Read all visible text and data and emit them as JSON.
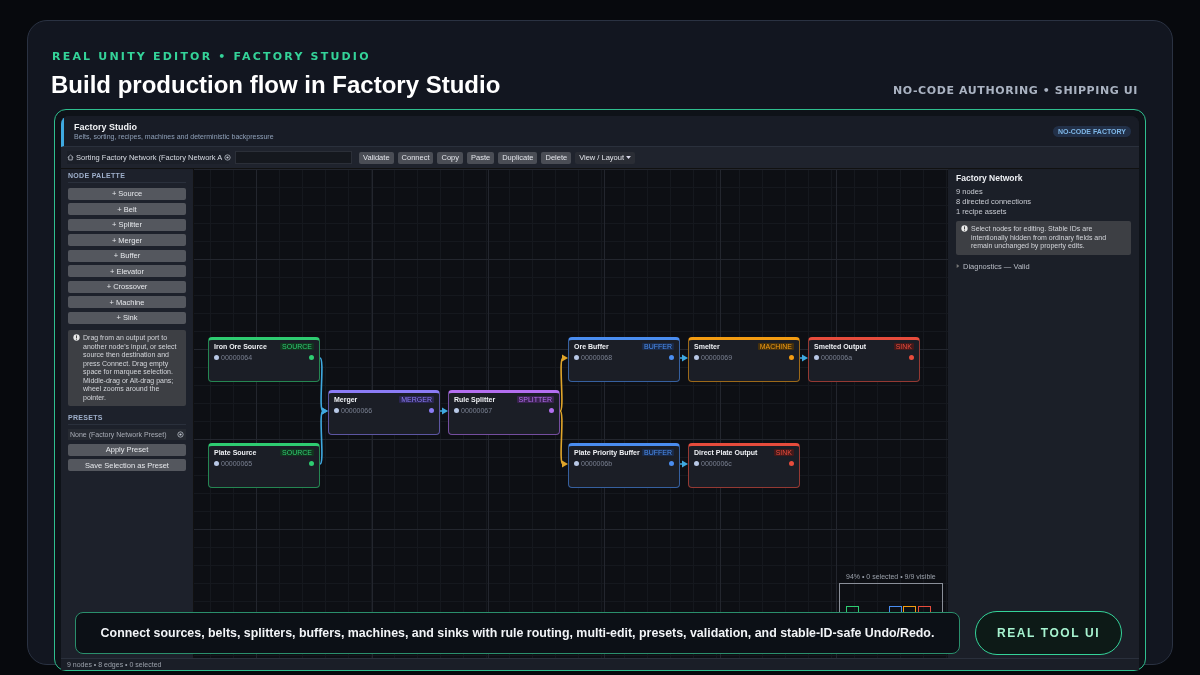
{
  "hero": {
    "eyebrow": "REAL UNITY EDITOR • FACTORY STUDIO",
    "title": "Build production flow in Factory Studio",
    "tagline": "NO-CODE AUTHORING • SHIPPING UI"
  },
  "editor": {
    "title": "Factory Studio",
    "subtitle": "Belts, sorting, recipes, machines and deterministic backpressure",
    "badge": "NO-CODE FACTORY"
  },
  "toolbar": {
    "network_field": "Sorting Factory Network (Factory Network A",
    "buttons": [
      "Validate",
      "Connect",
      "Copy",
      "Paste",
      "Duplicate",
      "Delete"
    ],
    "menu": "View / Layout"
  },
  "palette": {
    "heading": "NODE PALETTE",
    "buttons": [
      "+ Source",
      "+ Belt",
      "+ Splitter",
      "+ Merger",
      "+ Buffer",
      "+ Elevator",
      "+ Crossover",
      "+ Machine",
      "+ Sink"
    ],
    "hint": "Drag from an output port to another node's input, or select source then destination and press Connect. Drag empty space for marquee selection. Middle-drag or Alt-drag pans; wheel zooms around the pointer."
  },
  "presets": {
    "heading": "PRESETS",
    "field": "None (Factory Network Preset)",
    "buttons": [
      "Apply Preset",
      "Save Selection as Preset"
    ]
  },
  "nodes": [
    {
      "title": "Iron Ore Source",
      "kind": "source",
      "badge": "SOURCE",
      "id": "00000064"
    },
    {
      "title": "Plate Source",
      "kind": "source",
      "badge": "SOURCE",
      "id": "00000065"
    },
    {
      "title": "Merger",
      "kind": "merger",
      "badge": "MERGER",
      "id": "00000066"
    },
    {
      "title": "Rule Splitter",
      "kind": "splitter",
      "badge": "SPLITTER",
      "id": "00000067"
    },
    {
      "title": "Ore Buffer",
      "kind": "buffer",
      "badge": "BUFFER",
      "id": "00000068"
    },
    {
      "title": "Smelter",
      "kind": "machine",
      "badge": "MACHINE",
      "id": "00000069"
    },
    {
      "title": "Smelted Output",
      "kind": "sink",
      "badge": "SINK",
      "id": "0000006a"
    },
    {
      "title": "Plate Priority Buffer",
      "kind": "buffer",
      "badge": "BUFFER",
      "id": "0000006b"
    },
    {
      "title": "Direct Plate Output",
      "kind": "sink",
      "badge": "SINK",
      "id": "0000006c"
    }
  ],
  "edges": [
    {
      "color": "#3fa9e0"
    },
    {
      "color": "#3fa9e0"
    },
    {
      "color": "#3fa9e0"
    },
    {
      "color": "#e0a52a"
    },
    {
      "color": "#e0a52a"
    },
    {
      "color": "#3fa9e0"
    },
    {
      "color": "#3fa9e0"
    },
    {
      "color": "#3fa9e0"
    }
  ],
  "minimap": {
    "caption": "94% • 0 selected • 9/9 visible"
  },
  "inspector": {
    "title": "Factory Network",
    "stats": [
      "9 nodes",
      "8 directed connections",
      "1 recipe assets"
    ],
    "hint": "Select nodes for editing. Stable IDs are intentionally hidden from ordinary fields and remain unchanged by property edits.",
    "diagnostics": {
      "label": "Diagnostics — Valid",
      "expanded": false
    }
  },
  "status_bar": "9 nodes • 8 edges • 0 selected",
  "caption": "Connect sources, belts, splitters, buffers, machines, and sinks with rule routing, multi-edit, presets, validation, and stable-ID-safe Undo/Redo.",
  "cta": "REAL TOOL UI"
}
